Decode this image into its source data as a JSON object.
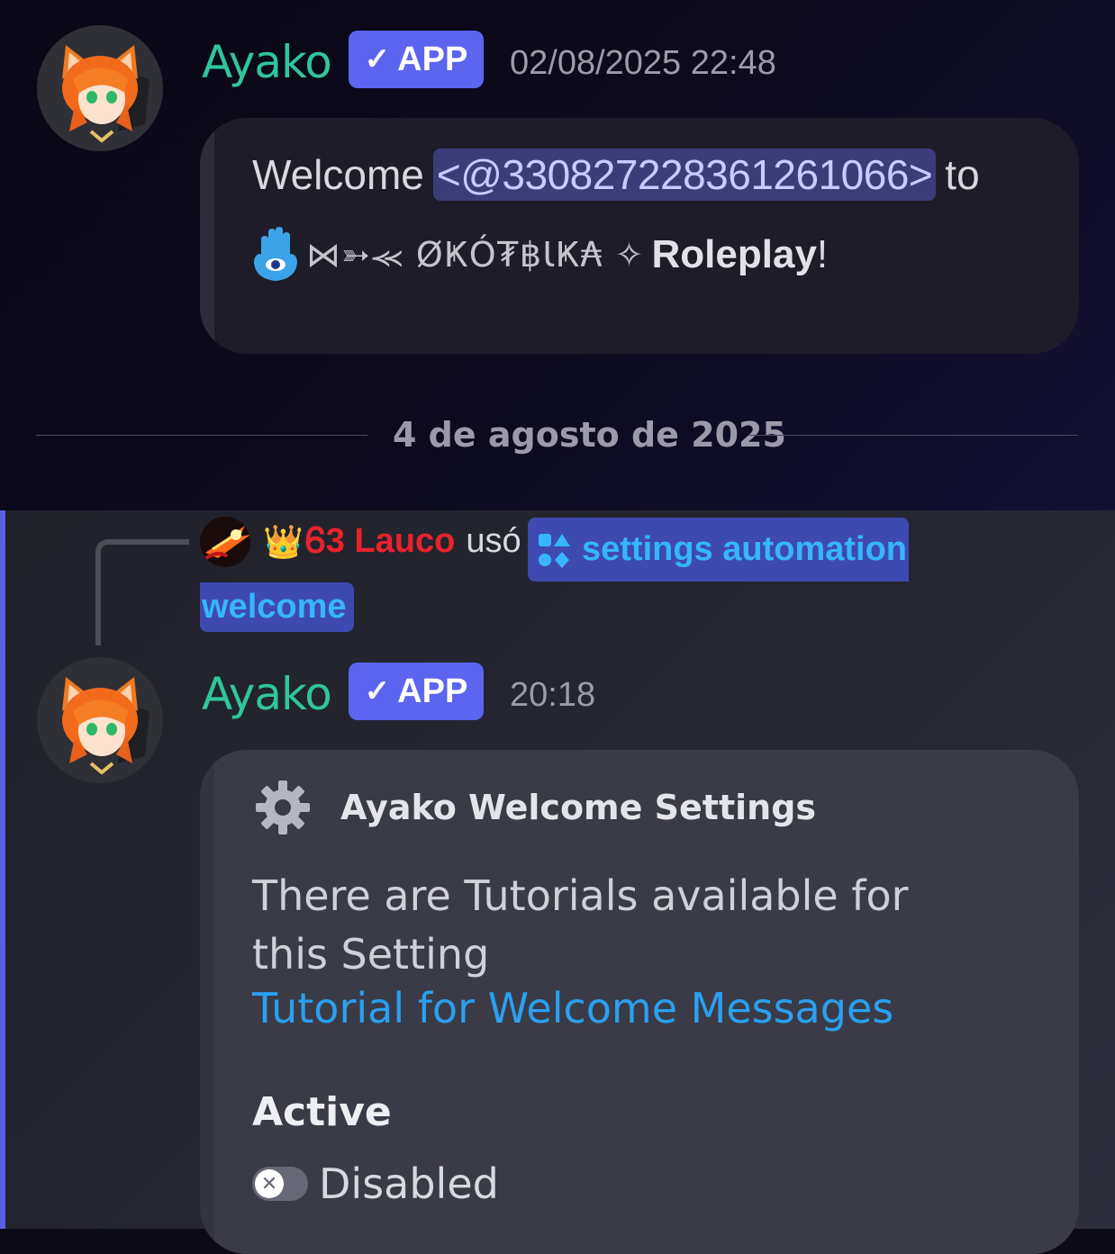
{
  "messages": [
    {
      "author": "Ayako",
      "badge": "APP",
      "timestamp": "02/08/2025 22:48",
      "welcome_prefix": "Welcome",
      "mention": "<@330827228361261066>",
      "welcome_suffix": "to",
      "server_emoji": "hamsa-eye-icon",
      "server_name": "⋈➳⪻ ØҜÓ₮฿ƖҜ₳ ✧",
      "server_suffix": "Roleplay",
      "server_end": "!"
    },
    {
      "author": "Ayako",
      "badge": "APP",
      "timestamp": "20:18",
      "embed": {
        "icon": "gear-icon",
        "title": "Ayako Welcome Settings",
        "description": "There are Tutorials available for this Setting",
        "link": "Tutorial for Welcome Messages",
        "field_name": "Active",
        "field_value": "Disabled"
      }
    }
  ],
  "date_divider": "4 de agosto de 2025",
  "reply": {
    "crown": "👑",
    "user": "Ꮾ3 Lauco",
    "action": "usó",
    "command_part1": "settings automation",
    "command_part2": "welcome"
  },
  "colors": {
    "author": "#2ec79a",
    "app_badge": "#5b65f0",
    "mention_bg": "#3b3d78",
    "link": "#2aa0f0",
    "reply_user": "#e8232c",
    "command": "#35b6ff"
  }
}
